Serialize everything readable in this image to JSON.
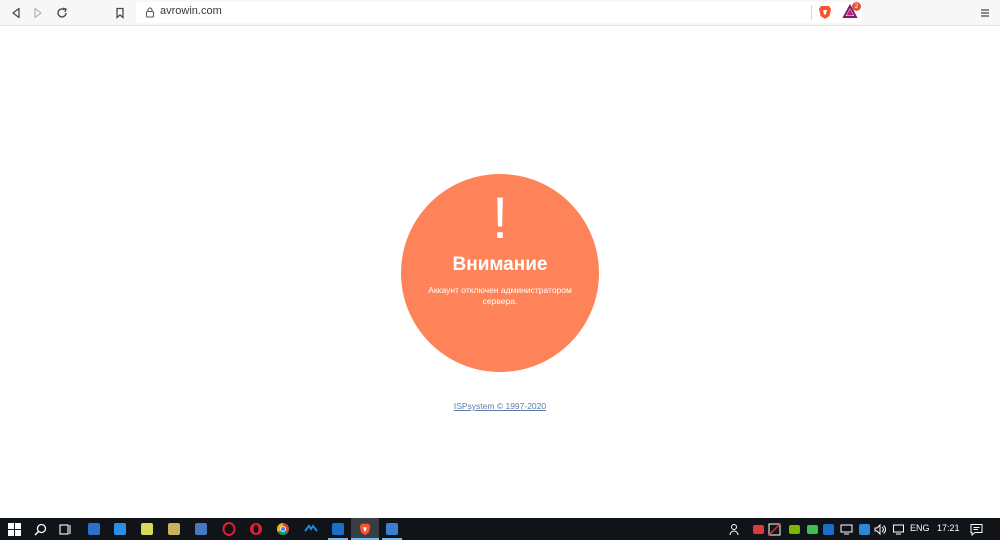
{
  "browser": {
    "url": "avrowin.com",
    "shields_badge_count": "2"
  },
  "page": {
    "exclamation": "!",
    "heading": "Внимание",
    "message": "Аккаунт отключен администратором сервера.",
    "footer_link": "ISPsystem © 1997-2020",
    "circle_color": "#ff8358"
  },
  "taskbar": {
    "language": "ENG",
    "time": "17:21",
    "pinned_apps": [
      "terminal-app",
      "trello-app",
      "notepad-app",
      "file-manager-app",
      "remote-app",
      "opera-app",
      "opera-gx-app",
      "chrome-app",
      "app-bird",
      "outlook-app",
      "brave-app",
      "remote-desktop-app"
    ]
  }
}
